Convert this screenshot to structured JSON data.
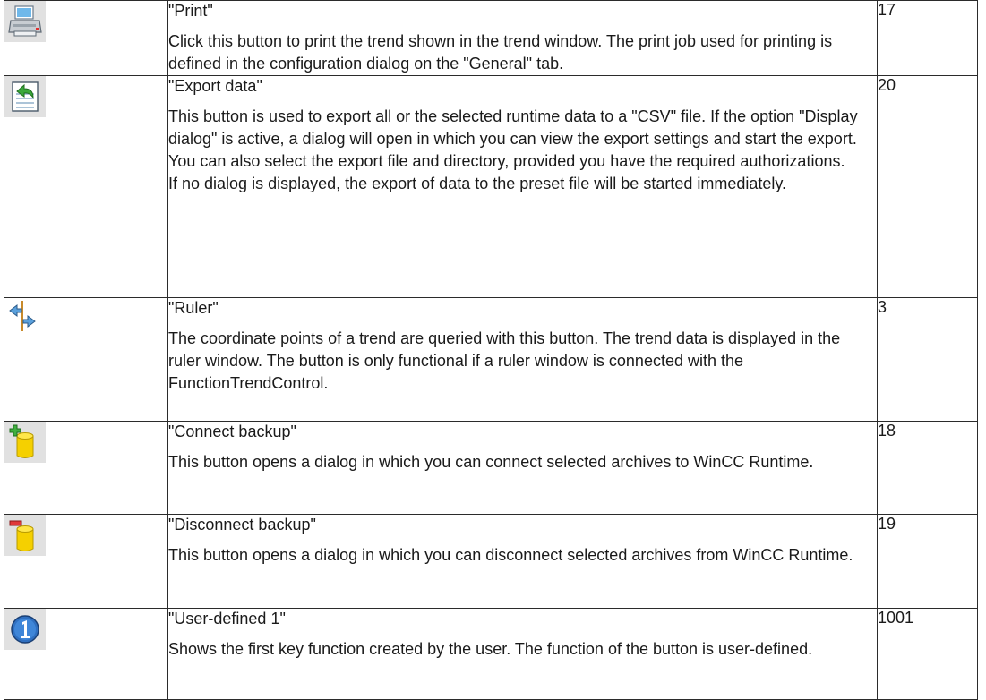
{
  "rows": [
    {
      "icon": "printer-icon",
      "title": "\"Print\"",
      "description": "Click this button to print the trend shown in the trend window. The print job used for printing is defined in the configuration dialog on the \"General\" tab.",
      "id": "17"
    },
    {
      "icon": "export-data-icon",
      "title": "\"Export data\"",
      "description": "This button is used to export all or the selected runtime data to a \"CSV\" file. If the option \"Display dialog\" is active, a dialog will open in which you can view the export settings and start the export. You can also select the export file and directory, provided you have the required authorizations.\nIf no dialog is displayed, the export of data to the preset file will be started immediately.",
      "id": "20"
    },
    {
      "icon": "ruler-icon",
      "title": "\"Ruler\"",
      "description": "The coordinate points of a trend are queried with this button. The trend data is displayed in the ruler window. The button is only functional if a ruler window is connected with the FunctionTrendControl.",
      "id": "3"
    },
    {
      "icon": "connect-backup-icon",
      "title": "\"Connect backup\"",
      "description": "This button opens a dialog in which you can connect selected archives to WinCC Runtime.",
      "id": "18"
    },
    {
      "icon": "disconnect-backup-icon",
      "title": "\"Disconnect backup\"",
      "description": "This button opens a dialog in which you can disconnect selected archives from WinCC Runtime.",
      "id": "19"
    },
    {
      "icon": "user-defined-1-icon",
      "title": "\"User-defined 1\"",
      "description": "Shows the first key function created by the user. The function of the button is user-defined.",
      "id": "1001"
    }
  ]
}
